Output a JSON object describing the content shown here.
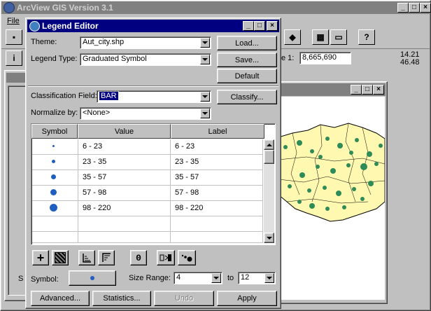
{
  "app": {
    "title": "ArcView GIS Version 3.1",
    "menu_file": "File",
    "scale_label": "e 1:",
    "scale_value": "8,665,690",
    "coord_x": "14.21",
    "coord_y": "46.48",
    "side_label": "S"
  },
  "dialog": {
    "title": "Legend Editor",
    "theme_label": "Theme:",
    "theme_value": "Aut_city.shp",
    "legend_type_label": "Legend Type:",
    "legend_type_value": "Graduated Symbol",
    "load_label": "Load...",
    "save_label": "Save...",
    "default_label": "Default",
    "classification_label": "Classification Field:",
    "classification_value": "BAR",
    "classify_label": "Classify...",
    "normalize_label": "Normalize by:",
    "normalize_value": "<None>",
    "columns": [
      "Symbol",
      "Value",
      "Label"
    ],
    "rows": [
      {
        "value": "6 - 23",
        "label": "6 - 23"
      },
      {
        "value": "23 - 35",
        "label": "23 - 35"
      },
      {
        "value": "35 - 57",
        "label": "35 - 57"
      },
      {
        "value": "57 - 98",
        "label": "57 - 98"
      },
      {
        "value": "98 - 220",
        "label": "98 - 220"
      }
    ],
    "tool_icons": [
      "add-icon",
      "delete-icon",
      "sort-ascending-icon",
      "sort-descending-icon",
      "null-value-icon",
      "flip-symbols-icon",
      "graduate-symbols-icon"
    ],
    "tool_null_glyph": "0",
    "symbol_label": "Symbol:",
    "size_range_label": "Size Range:",
    "size_from": "4",
    "size_to_label": "to",
    "size_to": "12",
    "advanced_label": "Advanced...",
    "statistics_label": "Statistics...",
    "undo_label": "Undo",
    "apply_label": "Apply"
  },
  "colors": {
    "title_bar": "#000080",
    "map_fill": "#fff8b0",
    "map_point": "#2e8b57",
    "symbol_blue": "#1f5fbf"
  }
}
